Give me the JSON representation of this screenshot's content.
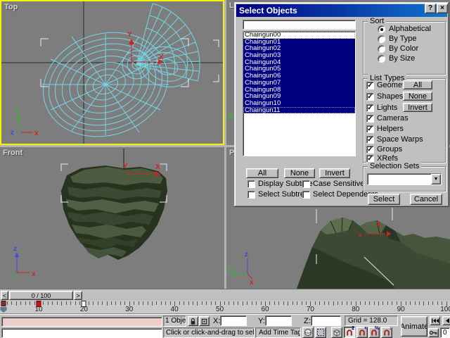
{
  "viewports": {
    "top_label": "Top",
    "front_label": "Front",
    "left_label": "Le",
    "perspective_label": "Pe"
  },
  "dialog": {
    "title": "Select Objects",
    "help_button": "?",
    "close_button": "×",
    "name_filter_value": "",
    "object_list": [
      {
        "label": "Chaingun00",
        "selected": false,
        "focus": true
      },
      {
        "label": "Chaingun01",
        "selected": true,
        "focus": false
      },
      {
        "label": "Chaingun02",
        "selected": true,
        "focus": false
      },
      {
        "label": "Chaingun03",
        "selected": true,
        "focus": false
      },
      {
        "label": "Chaingun04",
        "selected": true,
        "focus": false
      },
      {
        "label": "Chaingun05",
        "selected": true,
        "focus": false
      },
      {
        "label": "Chaingun06",
        "selected": true,
        "focus": false
      },
      {
        "label": "Chaingun07",
        "selected": true,
        "focus": false
      },
      {
        "label": "Chaingun08",
        "selected": true,
        "focus": false
      },
      {
        "label": "Chaingun09",
        "selected": true,
        "focus": false
      },
      {
        "label": "Chaingun10",
        "selected": true,
        "focus": false
      },
      {
        "label": "Chaingun11",
        "selected": true,
        "focus": true
      }
    ],
    "sort": {
      "title": "Sort",
      "options": [
        {
          "label": "Alphabetical",
          "selected": true
        },
        {
          "label": "By Type",
          "selected": false
        },
        {
          "label": "By Color",
          "selected": false
        },
        {
          "label": "By Size",
          "selected": false
        }
      ]
    },
    "list_types": {
      "title": "List Types",
      "buttons": [
        "All",
        "None",
        "Invert"
      ],
      "checkboxes": [
        {
          "label": "Geometry",
          "checked": true
        },
        {
          "label": "Shapes",
          "checked": true
        },
        {
          "label": "Lights",
          "checked": true
        },
        {
          "label": "Cameras",
          "checked": true
        },
        {
          "label": "Helpers",
          "checked": true
        },
        {
          "label": "Space Warps",
          "checked": true
        },
        {
          "label": "Groups",
          "checked": true
        },
        {
          "label": "XRefs",
          "checked": true
        }
      ]
    },
    "list_buttons": {
      "all": "All",
      "none": "None",
      "invert": "Invert"
    },
    "options": [
      {
        "label": "Display Subtree",
        "checked": false
      },
      {
        "label": "Case Sensitive",
        "checked": false
      },
      {
        "label": "Select Subtree",
        "checked": false
      },
      {
        "label": "Select Dependents",
        "checked": false
      }
    ],
    "selection_sets": {
      "title": "Selection Sets",
      "value": ""
    },
    "select_button": "Select",
    "cancel_button": "Cancel"
  },
  "timeline": {
    "prev_button": "<",
    "next_button": ">",
    "slider_label": "0 / 100",
    "tick_labels": [
      "10",
      "20",
      "30",
      "40",
      "50",
      "60",
      "70",
      "80",
      "90",
      "100"
    ],
    "keys": [
      {
        "frame": 0,
        "type": "slider"
      },
      {
        "frame": 10,
        "type": "key-selected"
      },
      {
        "frame": 20,
        "type": "key"
      }
    ]
  },
  "status_bar": {
    "selection_count": "1 Obje",
    "x_label": "X:",
    "y_label": "Y:",
    "z_label": "Z:",
    "x_value": "",
    "y_value": "",
    "z_value": "",
    "grid_status": "Grid = 128.0",
    "prompt": "Click or click-and-drag to selec",
    "time_tag_button": "Add Time Tag",
    "animate_button": "Animate",
    "current_frame": "0",
    "snap_superscripts": {
      "snap": "2",
      "angle": "+",
      "percent": "%",
      "spinner": "↕"
    }
  },
  "colors": {
    "titlebar_start": "#000080",
    "titlebar_end": "#1275cc",
    "selection": "#000080",
    "active_viewport_border": "#f6f400",
    "viewport_bg": "#7d7d7d",
    "wireframe": "#74d7e9",
    "mesh_base": "#3c4a33",
    "listener_pink": "#efcdcd",
    "key_red": "#c41414"
  }
}
